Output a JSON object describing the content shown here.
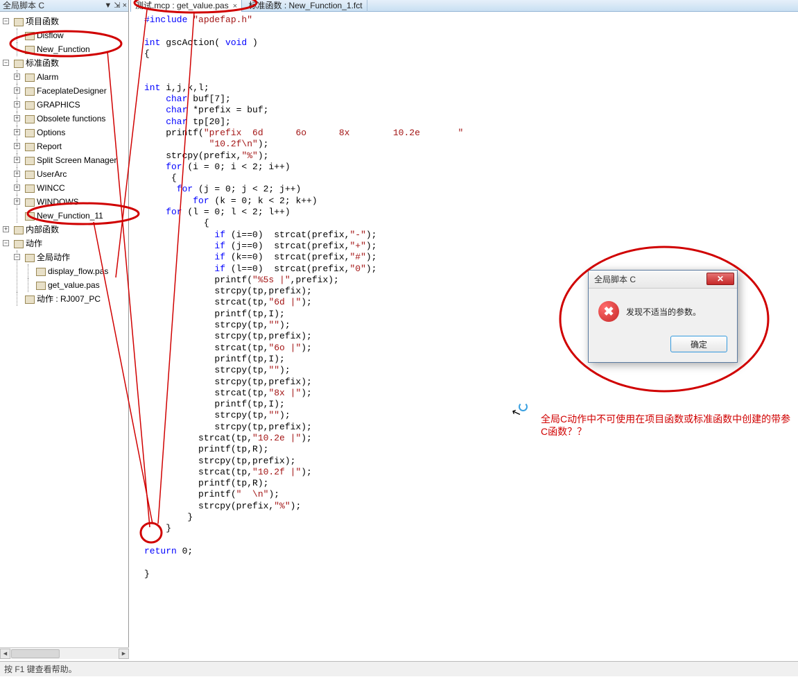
{
  "sidebar": {
    "title": "全局脚本 C",
    "title_buttons": "▼  ⇲  ×",
    "project_funcs": "项目函数",
    "pf_items": [
      "Disflow",
      "New_Function"
    ],
    "standard_funcs": "标准函数",
    "sf_items": [
      "Alarm",
      "FaceplateDesigner",
      "GRAPHICS",
      "Obsolete functions",
      "Options",
      "Report",
      "Split Screen Manager",
      "UserArc",
      "WINCC",
      "WINDOWS",
      "New_Function_11"
    ],
    "internal_funcs": "内部函数",
    "actions": "动作",
    "global_actions": "全局动作",
    "ga_items": [
      "display_flow.pas",
      "get_value.pas"
    ],
    "action_pc": "动作 : RJ007_PC"
  },
  "tabs": {
    "t1": "测试.mcp : get_value.pas",
    "t2": "标准函数 : New_Function_1.fct"
  },
  "code": {
    "l1a": "#include",
    "l1b": " \"apdefap.h\"",
    "l2": "",
    "l3a": "int",
    "l3b": " gscAction( ",
    "l3c": "void",
    "l3d": " )",
    "l4": "{",
    "l5": "",
    "l6": "",
    "l7a": "int",
    "l7b": " i,j,k,l;",
    "l8a": "    char",
    "l8b": " buf[7];",
    "l9a": "    char",
    "l9b": " *prefix = buf;",
    "l10a": "    char",
    "l10b": " tp[20];",
    "l11a": "    printf(",
    "l11b": "\"prefix  6d      6o      8x        10.2e       \"",
    "l12": "            \"10.2f\\n\"",
    "l12b": ");",
    "l13a": "    strcpy(prefix,",
    "l13b": "\"%\"",
    "l13c": ");",
    "l14a": "    for",
    "l14b": " (i = 0; i < 2; i++)",
    "l15": "     {",
    "l16a": "      for",
    "l16b": " (j = 0; j < 2; j++)",
    "l17a": "         for",
    "l17b": " (k = 0; k < 2; k++)",
    "l18a": "    for",
    "l18b": " (l = 0; l < 2; l++)",
    "l19": "           {",
    "l20a": "             if",
    "l20b": " (i==0)  strcat(prefix,",
    "l20c": "\"-\"",
    "l20d": ");",
    "l21a": "             if",
    "l21b": " (j==0)  strcat(prefix,",
    "l21c": "\"+\"",
    "l21d": ");",
    "l22a": "             if",
    "l22b": " (k==0)  strcat(prefix,",
    "l22c": "\"#\"",
    "l22d": ");",
    "l23a": "             if",
    "l23b": " (l==0)  strcat(prefix,",
    "l23c": "\"0\"",
    "l23d": ");",
    "l24a": "             printf(",
    "l24b": "\"%5s |\"",
    "l24c": ",prefix);",
    "l25": "             strcpy(tp,prefix);",
    "l26a": "             strcat(tp,",
    "l26b": "\"6d |\"",
    "l26c": ");",
    "l27": "             printf(tp,I);",
    "l28a": "             strcpy(tp,",
    "l28b": "\"\"",
    "l28c": ");",
    "l29": "             strcpy(tp,prefix);",
    "l30a": "             strcat(tp,",
    "l30b": "\"6o |\"",
    "l30c": ");",
    "l31": "             printf(tp,I);",
    "l32a": "             strcpy(tp,",
    "l32b": "\"\"",
    "l32c": ");",
    "l33": "             strcpy(tp,prefix);",
    "l34a": "             strcat(tp,",
    "l34b": "\"8x |\"",
    "l34c": ");",
    "l35": "             printf(tp,I);",
    "l36a": "             strcpy(tp,",
    "l36b": "\"\"",
    "l36c": ");",
    "l37": "             strcpy(tp,prefix);",
    "l38a": "          strcat(tp,",
    "l38b": "\"10.2e |\"",
    "l38c": ");",
    "l39": "          printf(tp,R);",
    "l40": "          strcpy(tp,prefix);",
    "l41a": "          strcat(tp,",
    "l41b": "\"10.2f |\"",
    "l41c": ");",
    "l42": "          printf(tp,R);",
    "l43a": "          printf(",
    "l43b": "\"  \\n\"",
    "l43c": ");",
    "l44a": "          strcpy(prefix,",
    "l44b": "\"%\"",
    "l44c": ");",
    "l45": "        }",
    "l46": "    }",
    "l47": "",
    "l48a": "return",
    "l48b": " 0;",
    "l49": "",
    "l50": "}"
  },
  "dialog": {
    "title": "全局脚本 C",
    "message": "发现不适当的参数。",
    "ok": "确定"
  },
  "annotation": "全局C动作中不可使用在项目函数或标准函数中创建的带参C函数？？",
  "status": "按 F1 键查看帮助。"
}
